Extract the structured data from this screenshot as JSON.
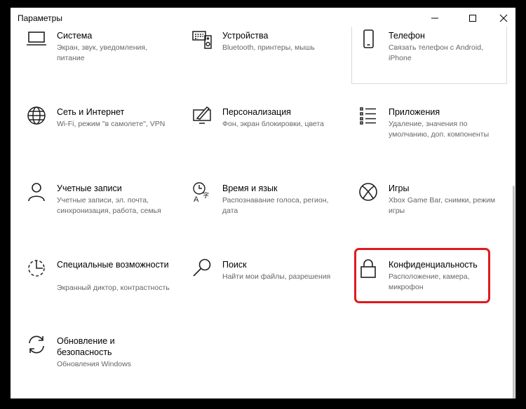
{
  "window": {
    "title": "Параметры",
    "controls": [
      "minimize-icon",
      "maximize-icon",
      "close-icon"
    ]
  },
  "tiles": [
    {
      "name": "Система",
      "desc": "Экран, звук, уведомления, питание",
      "icon": "laptop-icon"
    },
    {
      "name": "Устройства",
      "desc": "Bluetooth, принтеры, мышь",
      "icon": "keyboard-speaker-icon"
    },
    {
      "name": "Телефон",
      "desc": "Связать телефон с Android, iPhone",
      "icon": "phone-icon"
    },
    {
      "name": "Сеть и Интернет",
      "desc": "Wi-Fi, режим \"в самолете\", VPN",
      "icon": "globe-icon"
    },
    {
      "name": "Персонализация",
      "desc": "Фон, экран блокировки, цвета",
      "icon": "paint-monitor-icon"
    },
    {
      "name": "Приложения",
      "desc": "Удаление, значения по умолчанию, доп. компоненты",
      "icon": "app-list-icon"
    },
    {
      "name": "Учетные записи",
      "desc": "Учетные записи, эл. почта, синхронизация, работа, семья",
      "icon": "person-icon"
    },
    {
      "name": "Время и язык",
      "desc": "Распознавание голоса, регион, дата",
      "icon": "time-language-icon"
    },
    {
      "name": "Игры",
      "desc": "Xbox Game Bar, снимки, режим игры",
      "icon": "xbox-icon"
    },
    {
      "name": "Специальные возможности",
      "desc": "Экранный диктор, контрастность",
      "icon": "ease-of-access-icon"
    },
    {
      "name": "Поиск",
      "desc": "Найти мои файлы, разрешения",
      "icon": "search-icon"
    },
    {
      "name": "Конфиденциальность",
      "desc": "Расположение, камера, микрофон",
      "icon": "lock-icon"
    },
    {
      "name": "Обновление и безопасность",
      "desc": "Обновления Windows",
      "icon": "update-icon"
    }
  ],
  "highlight": {
    "tile": "Конфиденциальность",
    "color": "#e0191f"
  }
}
